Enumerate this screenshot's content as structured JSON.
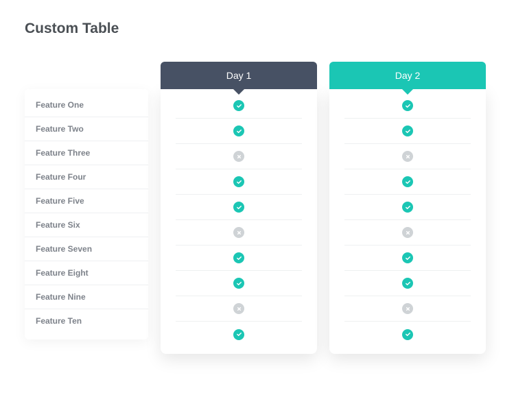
{
  "title": "Custom Table",
  "columns": [
    {
      "id": "day1",
      "label": "Day 1",
      "header_color": "#475164"
    },
    {
      "id": "day2",
      "label": "Day 2",
      "header_color": "#1bc6b4"
    }
  ],
  "features": [
    {
      "label": "Feature One",
      "day1": "check",
      "day2": "check"
    },
    {
      "label": "Feature Two",
      "day1": "check",
      "day2": "check"
    },
    {
      "label": "Feature Three",
      "day1": "cross",
      "day2": "cross"
    },
    {
      "label": "Feature Four",
      "day1": "check",
      "day2": "check"
    },
    {
      "label": "Feature Five",
      "day1": "check",
      "day2": "check"
    },
    {
      "label": "Feature Six",
      "day1": "cross",
      "day2": "cross"
    },
    {
      "label": "Feature Seven",
      "day1": "check",
      "day2": "check"
    },
    {
      "label": "Feature Eight",
      "day1": "check",
      "day2": "check"
    },
    {
      "label": "Feature Nine",
      "day1": "cross",
      "day2": "cross"
    },
    {
      "label": "Feature Ten",
      "day1": "check",
      "day2": "check"
    }
  ],
  "icons": {
    "check": "check-icon",
    "cross": "cross-icon"
  },
  "colors": {
    "accent_teal": "#1bc6b4",
    "header_slate": "#475164",
    "muted_gray": "#cfd3d6"
  }
}
